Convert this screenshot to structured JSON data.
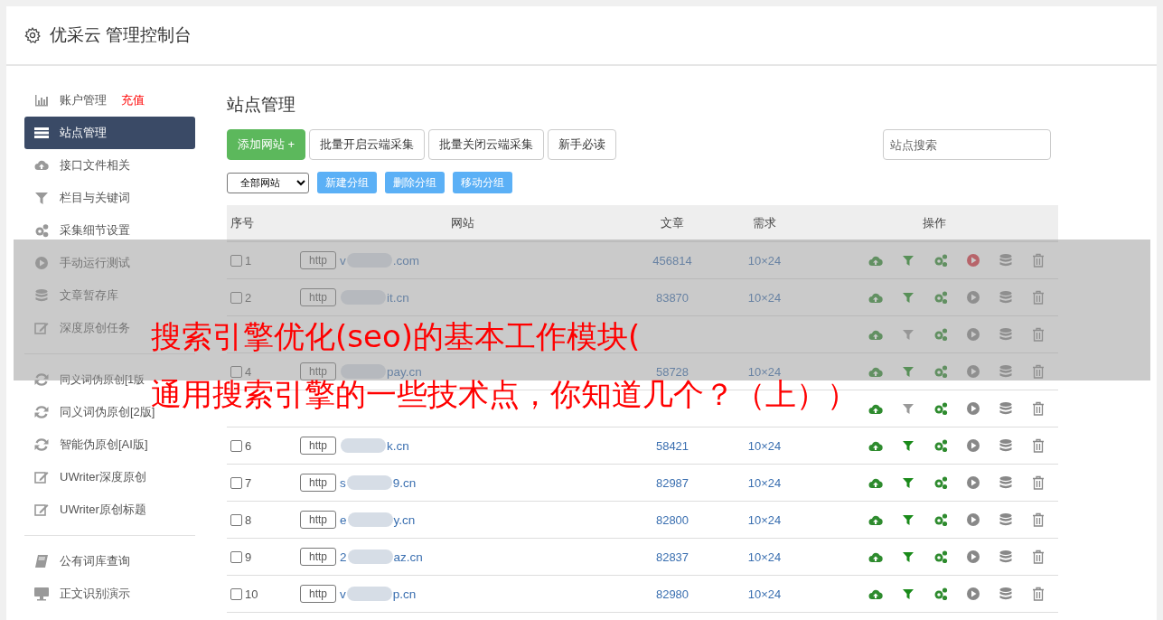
{
  "header": {
    "title": "优采云 管理控制台"
  },
  "sidebar": {
    "groups": [
      [
        {
          "label": "账户管理",
          "badge": "充值",
          "selected": false
        },
        {
          "label": "站点管理",
          "selected": true
        },
        {
          "label": "接口文件相关",
          "selected": false
        },
        {
          "label": "栏目与关键词",
          "selected": false
        },
        {
          "label": "采集细节设置",
          "selected": false
        },
        {
          "label": "手动运行测试",
          "selected": false
        },
        {
          "label": "文章暂存库",
          "selected": false
        },
        {
          "label": "深度原创任务",
          "selected": false
        }
      ],
      [
        {
          "label": "同义词伪原创[1版",
          "selected": false
        },
        {
          "label": "同义词伪原创[2版]",
          "selected": false
        },
        {
          "label": "智能伪原创[AI版]",
          "selected": false
        },
        {
          "label": "UWriter深度原创",
          "selected": false
        },
        {
          "label": "UWriter原创标题",
          "selected": false
        }
      ],
      [
        {
          "label": "公有词库查询",
          "selected": false
        },
        {
          "label": "正文识别演示",
          "selected": false
        }
      ]
    ]
  },
  "main": {
    "title": "站点管理",
    "toolbar": [
      {
        "label": "添加网站 +",
        "kind": "primary"
      },
      {
        "label": "批量开启云端采集",
        "kind": "default"
      },
      {
        "label": "批量关闭云端采集",
        "kind": "default"
      },
      {
        "label": "新手必读",
        "kind": "default"
      }
    ],
    "search": {
      "placeholder": "站点搜索"
    },
    "group_select": {
      "value": "全部网站"
    },
    "group_buttons": [
      "新建分组",
      "删除分组",
      "移动分组"
    ],
    "table": {
      "columns": [
        "序号",
        "网站",
        "文章",
        "需求",
        "操作"
      ],
      "rows": [
        {
          "no": "1",
          "checked": false,
          "scheme": "http",
          "site_start": "v",
          "site_end": ".com",
          "articles": "456814",
          "demand": "10×24",
          "filter_on": true,
          "running": true
        },
        {
          "no": "2",
          "checked": false,
          "scheme": "http",
          "site_start": "",
          "site_end": "it.cn",
          "articles": "83870",
          "demand": "10×24",
          "filter_on": true,
          "running": false
        },
        {
          "filter_on": false,
          "running": false
        },
        {
          "no": "4",
          "checked": false,
          "scheme": "http",
          "site_start": "",
          "site_end": "pay.cn",
          "articles": "58728",
          "demand": "10×24",
          "filter_on": true,
          "running": false
        },
        {
          "filter_on": false,
          "running": false
        },
        {
          "no": "6",
          "checked": false,
          "scheme": "http",
          "site_start": "",
          "site_end": "k.cn",
          "articles": "58421",
          "demand": "10×24",
          "filter_on": true,
          "running": false
        },
        {
          "no": "7",
          "checked": false,
          "scheme": "http",
          "site_start": "s",
          "site_end": "9.cn",
          "articles": "82987",
          "demand": "10×24",
          "filter_on": true,
          "running": false
        },
        {
          "no": "8",
          "checked": false,
          "scheme": "http",
          "site_start": "e",
          "site_end": "y.cn",
          "articles": "82800",
          "demand": "10×24",
          "filter_on": true,
          "running": false
        },
        {
          "no": "9",
          "checked": false,
          "scheme": "http",
          "site_start": "2",
          "site_end": "az.cn",
          "articles": "82837",
          "demand": "10×24",
          "filter_on": true,
          "running": false
        },
        {
          "no": "10",
          "checked": false,
          "scheme": "http",
          "site_start": "v",
          "site_end": "p.cn",
          "articles": "82980",
          "demand": "10×24",
          "filter_on": true,
          "running": false
        }
      ]
    }
  },
  "overlay": {
    "lines": [
      "搜索引擎优化(seo)的基本工作模块(",
      "通用搜索引擎的一些技术点，你知道几个？（上））"
    ]
  }
}
